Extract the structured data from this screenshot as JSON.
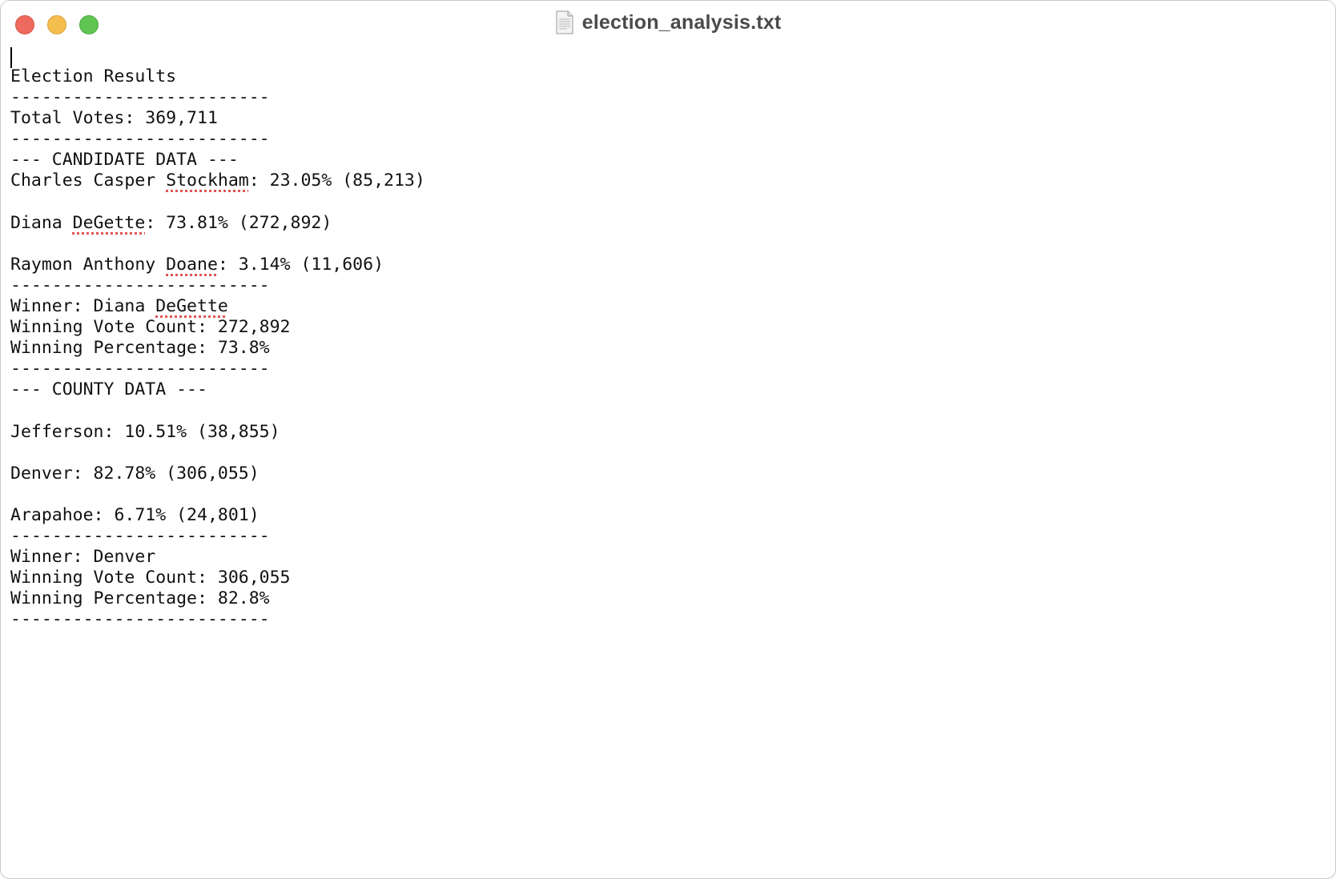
{
  "window": {
    "title": "election_analysis.txt",
    "icon": "text-document-icon",
    "controls": [
      "close-button",
      "minimize-button",
      "zoom-button"
    ]
  },
  "document": {
    "lines": [
      "Election Results",
      "-------------------------",
      "Total Votes: 369,711",
      "-------------------------",
      "--- CANDIDATE DATA ---",
      "Charles Casper Stockham: 23.05% (85,213)",
      "",
      "Diana DeGette: 73.81% (272,892)",
      "",
      "Raymon Anthony Doane: 3.14% (11,606)",
      "-------------------------",
      "Winner: Diana DeGette",
      "Winning Vote Count: 272,892",
      "Winning Percentage: 73.8%",
      "-------------------------",
      "--- COUNTY DATA ---",
      "",
      "Jefferson: 10.51% (38,855)",
      "",
      "Denver: 82.78% (306,055)",
      "",
      "Arapahoe: 6.71% (24,801)",
      "-------------------------",
      "Winner: Denver",
      "Winning Vote Count: 306,055",
      "Winning Percentage: 82.8%",
      "-------------------------"
    ],
    "spellcheck_flagged_words": [
      "Stockham",
      "DeGette",
      "Doane"
    ]
  },
  "colors": {
    "close": "#ee6a5f",
    "minimize": "#f5bf4f",
    "zoom": "#61c554",
    "spellcheck_underline": "#e05555"
  }
}
